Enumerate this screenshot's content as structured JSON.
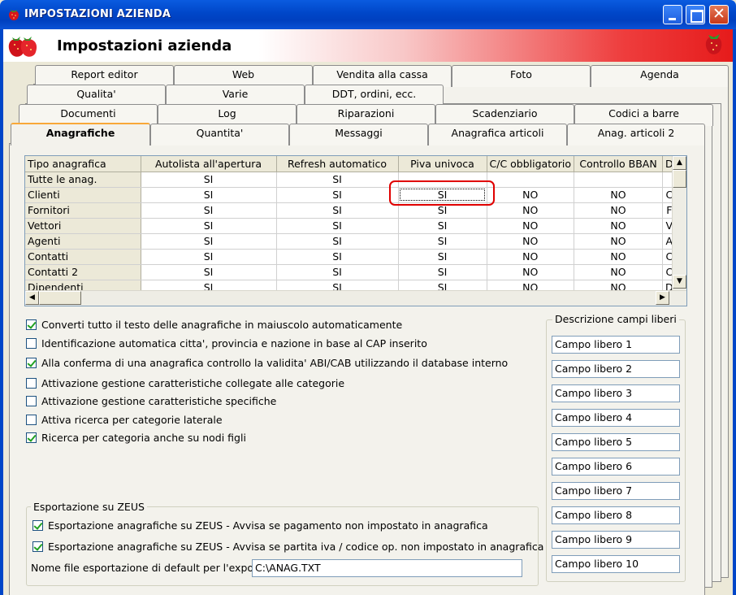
{
  "window": {
    "title": "IMPOSTAZIONI AZIENDA",
    "icon": "strawberry-icon"
  },
  "header": {
    "title": "Impostazioni azienda",
    "logo": "strawberry-logo"
  },
  "tabs": {
    "row1": [
      "Report editor",
      "Web",
      "Vendita alla cassa",
      "Foto",
      "Agenda"
    ],
    "row2": [
      "Qualita'",
      "Varie",
      "DDT, ordini, ecc."
    ],
    "row3": [
      "Documenti",
      "Log",
      "Riparazioni",
      "Scadenziario",
      "Codici a barre"
    ],
    "row4": [
      "Anagrafiche",
      "Quantita'",
      "Messaggi",
      "Anagrafica articoli",
      "Anag. articoli 2"
    ],
    "active": "Anagrafiche"
  },
  "grid": {
    "headers": [
      "Tipo anagrafica",
      "Autolista all'apertura",
      "Refresh automatico",
      "Piva univoca",
      "C/C obbligatorio",
      "Controllo BBAN",
      "D"
    ],
    "rows": [
      [
        "Tutte le anag.",
        "SI",
        "SI",
        "",
        "",
        "",
        ""
      ],
      [
        "Clienti",
        "SI",
        "SI",
        "SI",
        "NO",
        "NO",
        "C"
      ],
      [
        "Fornitori",
        "SI",
        "SI",
        "SI",
        "NO",
        "NO",
        "F"
      ],
      [
        "Vettori",
        "SI",
        "SI",
        "SI",
        "NO",
        "NO",
        "V"
      ],
      [
        "Agenti",
        "SI",
        "SI",
        "SI",
        "NO",
        "NO",
        "A"
      ],
      [
        "Contatti",
        "SI",
        "SI",
        "SI",
        "NO",
        "NO",
        "C"
      ],
      [
        "Contatti 2",
        "SI",
        "SI",
        "SI",
        "NO",
        "NO",
        "C"
      ],
      [
        "Dipendenti",
        "SI",
        "SI",
        "SI",
        "NO",
        "NO",
        "D"
      ]
    ]
  },
  "options": [
    {
      "label": "Converti tutto il testo delle anagrafiche in maiuscolo automaticamente",
      "checked": true
    },
    {
      "label": "Identificazione automatica citta', provincia e nazione in base al CAP inserito",
      "checked": false
    },
    {
      "label": "Alla conferma di una anagrafica controllo la validita' ABI/CAB utilizzando il database interno",
      "checked": true
    },
    {
      "label": "Attivazione gestione caratteristiche collegate alle categorie",
      "checked": false
    },
    {
      "label": "Attivazione gestione caratteristiche specifiche",
      "checked": false
    },
    {
      "label": "Attiva ricerca per categorie laterale",
      "checked": false
    },
    {
      "label": "Ricerca per categoria anche su nodi figli",
      "checked": true
    }
  ],
  "zeus": {
    "legend": "Esportazione su ZEUS",
    "options": [
      {
        "label": "Esportazione anagrafiche su ZEUS - Avvisa se pagamento non impostato in anagrafica",
        "checked": true
      },
      {
        "label": "Esportazione anagrafiche su ZEUS - Avvisa se partita iva / codice op. non impostato in anagrafica",
        "checked": true
      }
    ],
    "file_label": "Nome file esportazione di default per l'export :",
    "file_value": "C:\\ANAG.TXT"
  },
  "campi_liberi": {
    "legend": "Descrizione campi liberi",
    "values": [
      "Campo libero 1",
      "Campo libero 2",
      "Campo libero 3",
      "Campo libero 4",
      "Campo libero 5",
      "Campo libero 6",
      "Campo libero 7",
      "Campo libero 8",
      "Campo libero 9",
      "Campo libero 10"
    ]
  },
  "colors": {
    "title_bar": "#0046C8",
    "header_red": "#E61B1B",
    "highlight": "#E00000",
    "tab_active_accent": "#F9A838"
  }
}
